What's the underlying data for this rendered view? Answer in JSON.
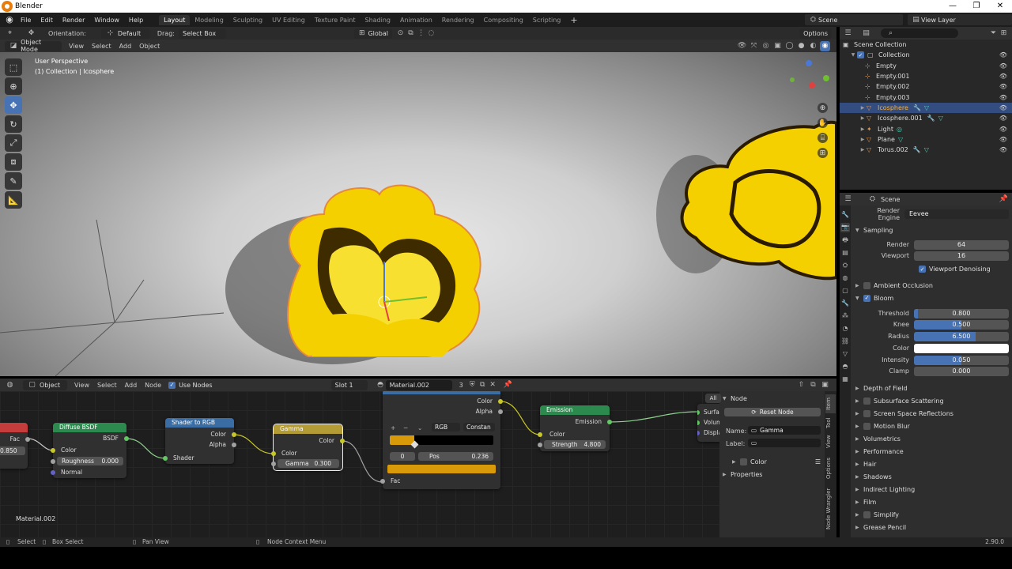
{
  "titlebar": {
    "title": "Blender",
    "min": "—",
    "max": "❐",
    "close": "✕"
  },
  "menu": {
    "items": [
      "File",
      "Edit",
      "Render",
      "Window",
      "Help"
    ]
  },
  "workspaces": [
    "Layout",
    "Modeling",
    "Sculpting",
    "UV Editing",
    "Texture Paint",
    "Shading",
    "Animation",
    "Rendering",
    "Compositing",
    "Scripting"
  ],
  "scene_selector": {
    "scene": "Scene",
    "view_layer": "View Layer"
  },
  "tool_header": {
    "orientation_label": "Orientation:",
    "orientation_value": "Default",
    "drag_label": "Drag:",
    "drag_value": "Select Box",
    "transform_orientation": "Global",
    "options": "Options"
  },
  "viewport_header": {
    "mode": "Object Mode",
    "menus": [
      "View",
      "Select",
      "Add",
      "Object"
    ]
  },
  "viewport": {
    "perspective": "User Perspective",
    "context": "(1) Collection | Icosphere"
  },
  "outliner": {
    "root": "Scene Collection",
    "collection": "Collection",
    "items": [
      {
        "name": "Empty"
      },
      {
        "name": "Empty.001"
      },
      {
        "name": "Empty.002"
      },
      {
        "name": "Empty.003"
      },
      {
        "name": "Icosphere"
      },
      {
        "name": "Icosphere.001"
      },
      {
        "name": "Light"
      },
      {
        "name": "Plane"
      },
      {
        "name": "Torus.002"
      }
    ]
  },
  "properties": {
    "context": "Scene",
    "render_engine_label": "Render Engine",
    "render_engine": "Eevee",
    "sampling": {
      "title": "Sampling",
      "render_label": "Render",
      "render": "64",
      "viewport_label": "Viewport",
      "viewport": "16",
      "denoise": "Viewport Denoising"
    },
    "ambient_occlusion": "Ambient Occlusion",
    "bloom": {
      "title": "Bloom",
      "threshold_label": "Threshold",
      "threshold": "0.800",
      "knee_label": "Knee",
      "knee": "0.500",
      "knee_fill": 0.5,
      "radius_label": "Radius",
      "radius": "6.500",
      "radius_fill": 0.65,
      "color_label": "Color",
      "color": "#ffffff",
      "intensity_label": "Intensity",
      "intensity": "0.050",
      "intensity_fill": 0.5,
      "clamp_label": "Clamp",
      "clamp": "0.000"
    },
    "panels": [
      "Depth of Field",
      "Subsurface Scattering",
      "Screen Space Reflections",
      "Motion Blur",
      "Volumetrics",
      "Performance",
      "Hair",
      "Shadows",
      "Indirect Lighting",
      "Film",
      "Simplify",
      "Grease Pencil"
    ]
  },
  "node_header": {
    "editor_mode": "Object",
    "menus": [
      "View",
      "Select",
      "Add",
      "Node"
    ],
    "use_nodes": "Use Nodes",
    "slot": "Slot 1",
    "material": "Material.002",
    "users": "3"
  },
  "nodes": {
    "left_stub": {
      "fac_label": "Fac",
      "value": "0.850"
    },
    "diffuse": {
      "title": "Diffuse BSDF",
      "out": "BSDF",
      "color": "Color",
      "roughness_label": "Roughness",
      "roughness": "0.000",
      "normal": "Normal"
    },
    "shader_to_rgb": {
      "title": "Shader to RGB",
      "color": "Color",
      "alpha": "Alpha",
      "shader": "Shader"
    },
    "gamma": {
      "title": "Gamma",
      "out": "Color",
      "color": "Color",
      "gamma_label": "Gamma",
      "gamma": "0.300"
    },
    "color_ramp": {
      "title": "ColorRamp",
      "out_color": "Color",
      "out_alpha": "Alpha",
      "mode": "RGB",
      "interp": "Constan",
      "index": "0",
      "pos_label": "Pos",
      "pos": "0.236",
      "pos_fill": 0.236,
      "fac": "Fac",
      "stop_color": "#d99a0a"
    },
    "emission": {
      "title": "Emission",
      "out": "Emission",
      "color": "Color",
      "strength_label": "Strength",
      "strength": "4.800"
    },
    "output": {
      "surface": "Surface",
      "volume": "Volume",
      "displacement": "Displacement"
    },
    "frame_label": "Material.002"
  },
  "node_panel": {
    "filter": "All",
    "section": "Node",
    "reset": "Reset Node",
    "name_label": "Name:",
    "name": "Gamma",
    "label_label": "Label:",
    "label": "",
    "color_section": "Color",
    "properties_section": "Properties",
    "tabs": [
      "Item",
      "Tool",
      "View",
      "Options",
      "Node Wrangler"
    ]
  },
  "statusbar": {
    "select": "Select",
    "box_select": "Box Select",
    "pan_view": "Pan View",
    "context_menu": "Node Context Menu",
    "version": "2.90.0"
  }
}
